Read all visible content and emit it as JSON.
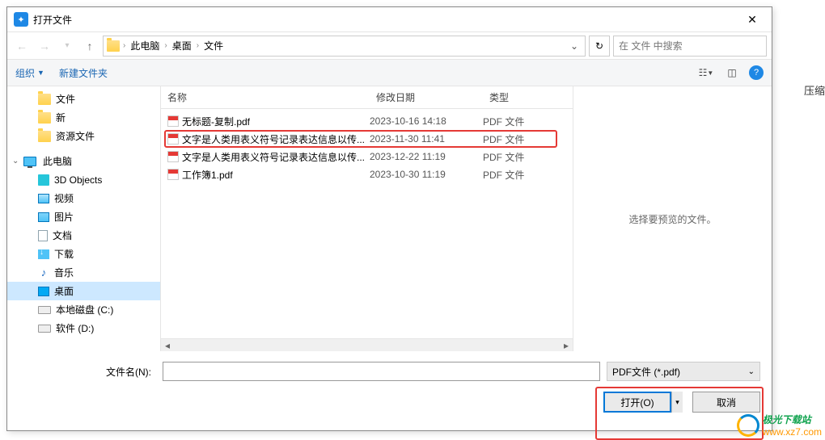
{
  "title": "打开文件",
  "nav": {
    "refresh": "↻"
  },
  "breadcrumb": {
    "root": "此电脑",
    "p1": "桌面",
    "p2": "文件"
  },
  "search": {
    "placeholder": "在 文件 中搜索"
  },
  "toolbar": {
    "organize": "组织",
    "new_folder": "新建文件夹"
  },
  "sidebar": {
    "items": [
      {
        "label": "文件"
      },
      {
        "label": "新"
      },
      {
        "label": "资源文件"
      }
    ],
    "pc_label": "此电脑",
    "pc_children": [
      {
        "label": "3D Objects"
      },
      {
        "label": "视频"
      },
      {
        "label": "图片"
      },
      {
        "label": "文档"
      },
      {
        "label": "下载"
      },
      {
        "label": "音乐"
      },
      {
        "label": "桌面"
      },
      {
        "label": "本地磁盘 (C:)"
      },
      {
        "label": "软件 (D:)"
      }
    ]
  },
  "columns": {
    "name": "名称",
    "date": "修改日期",
    "type": "类型"
  },
  "files": [
    {
      "name": "无标题-复制.pdf",
      "date": "2023-10-16 14:18",
      "type": "PDF 文件"
    },
    {
      "name": "文字是人类用表义符号记录表达信息以传...",
      "date": "2023-11-30 11:41",
      "type": "PDF 文件"
    },
    {
      "name": "文字是人类用表义符号记录表达信息以传...",
      "date": "2023-12-22 11:19",
      "type": "PDF 文件"
    },
    {
      "name": "工作簿1.pdf",
      "date": "2023-10-30 11:19",
      "type": "PDF 文件"
    }
  ],
  "preview": {
    "empty": "选择要预览的文件。"
  },
  "footer": {
    "filename_label": "文件名(N):",
    "filter": "PDF文件 (*.pdf)"
  },
  "buttons": {
    "open": "打开(O)",
    "cancel": "取消"
  },
  "bg": {
    "compress": "压缩"
  },
  "watermark": {
    "name": "极光下载站",
    "url": "www.xz7.com"
  }
}
